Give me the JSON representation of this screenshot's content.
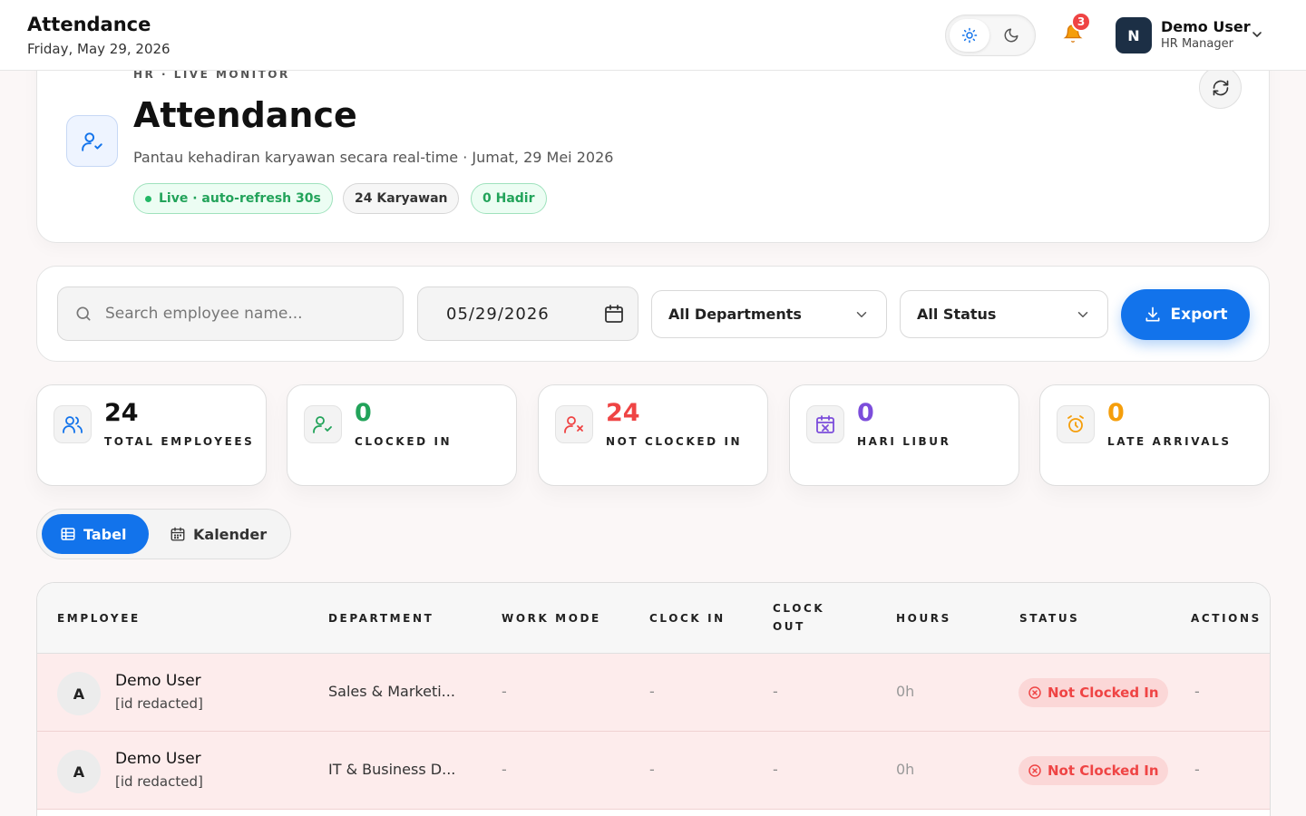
{
  "topbar": {
    "title": "Attendance",
    "date": "Friday, May 29, 2026",
    "notification_count": "3",
    "user": {
      "initial": "N",
      "name": "Demo User",
      "role": "HR Manager"
    }
  },
  "header": {
    "kicker": "HR · LIVE MONITOR",
    "title": "Attendance",
    "subtitle": "Pantau kehadiran karyawan secara real-time · Jumat, 29 Mei 2026",
    "chips": {
      "live": "Live · auto-refresh 30s",
      "employees": "24 Karyawan",
      "present": "0 Hadir"
    }
  },
  "filters": {
    "search_placeholder": "Search employee name...",
    "date": "05/29/2026",
    "department": "All Departments",
    "status": "All Status",
    "export_label": "Export"
  },
  "stats": [
    {
      "value": "24",
      "label": "TOTAL EMPLOYEES",
      "color": "#111111",
      "icon": "users-icon"
    },
    {
      "value": "0",
      "label": "CLOCKED IN",
      "color": "#22a35a",
      "icon": "user-check-icon"
    },
    {
      "value": "24",
      "label": "NOT CLOCKED IN",
      "color": "#ef4444",
      "icon": "user-x-icon"
    },
    {
      "value": "0",
      "label": "HARI LIBUR",
      "color": "#7c4ddb",
      "icon": "calendar-x-icon"
    },
    {
      "value": "0",
      "label": "LATE ARRIVALS",
      "color": "#f59e0b",
      "icon": "alarm-clock-icon"
    }
  ],
  "view_tabs": {
    "table": "Tabel",
    "calendar": "Kalender"
  },
  "table": {
    "headers": [
      "EMPLOYEE",
      "DEPARTMENT",
      "WORK MODE",
      "CLOCK IN",
      "CLOCK OUT",
      "HOURS",
      "STATUS",
      "ACTIONS"
    ],
    "rows": [
      {
        "initial": "A",
        "name": "Demo User",
        "id": "[id redacted]",
        "department": "Sales & Marketi...",
        "work_mode": "-",
        "clock_in": "-",
        "clock_out": "-",
        "hours": "0h",
        "status": "Not Clocked In",
        "actions": "-"
      },
      {
        "initial": "A",
        "name": "Demo User",
        "id": "[id redacted]",
        "department": "IT & Business D...",
        "work_mode": "-",
        "clock_in": "-",
        "clock_out": "-",
        "hours": "0h",
        "status": "Not Clocked In",
        "actions": "-"
      }
    ]
  },
  "colors": {
    "accent": "#1273eb",
    "danger": "#ef4444",
    "success": "#22a35a",
    "purple": "#7c4ddb",
    "amber": "#f59e0b"
  }
}
